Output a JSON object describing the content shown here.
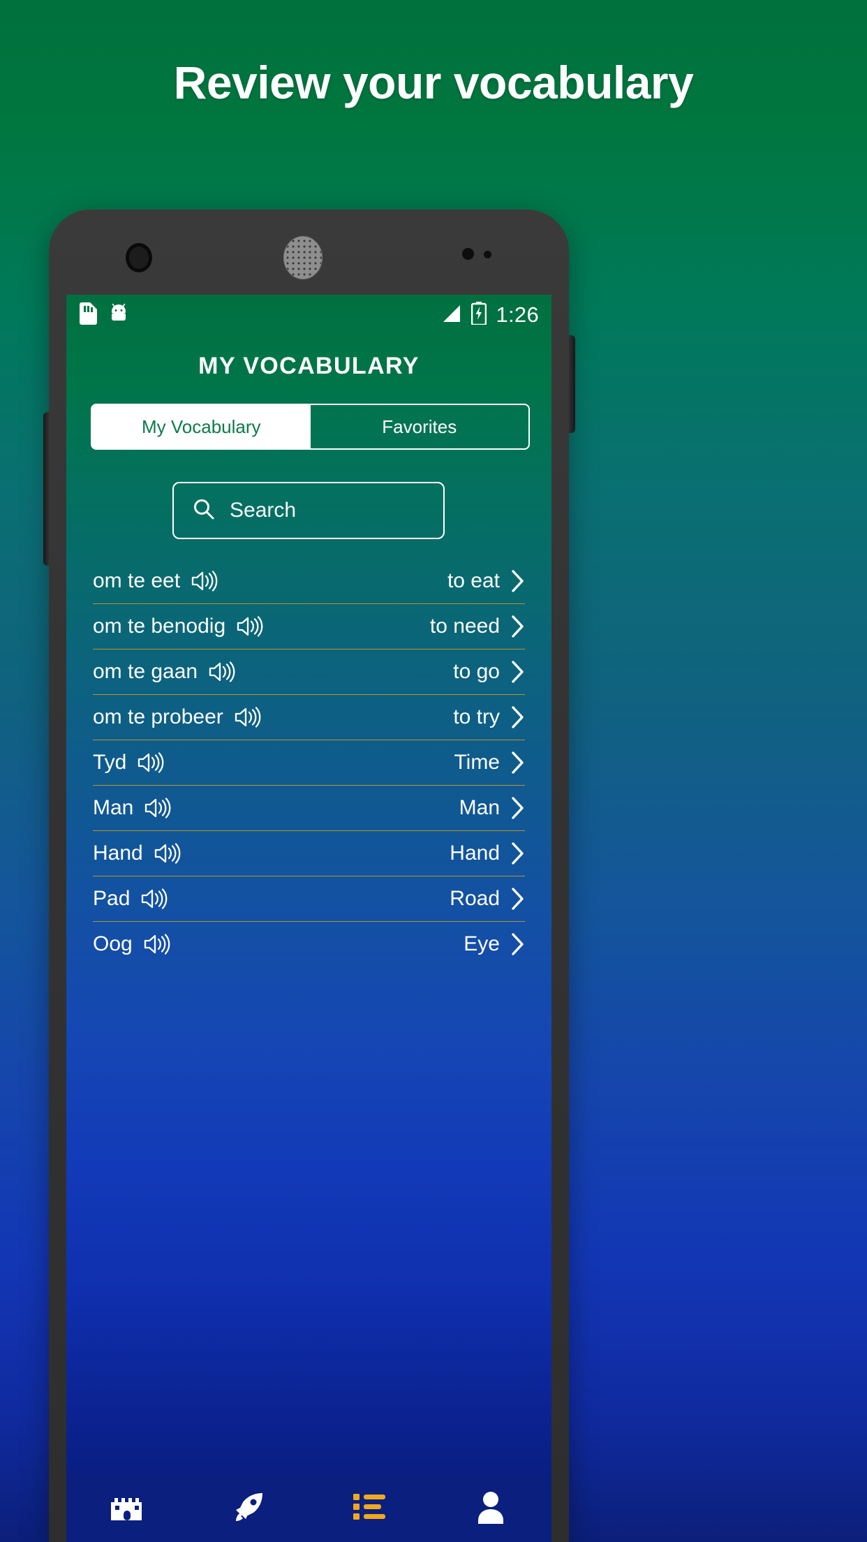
{
  "promo": {
    "headline": "Review your vocabulary"
  },
  "phone": {
    "hardware": {
      "camera": "front-camera",
      "speaker": "earpiece-speaker",
      "sensor_large": "proximity-sensor",
      "sensor_small": "light-sensor"
    }
  },
  "statusbar": {
    "left_icons": [
      "sim-card-icon",
      "android-robot-icon"
    ],
    "right_icons": [
      "signal-strength-icon",
      "battery-charging-icon"
    ],
    "time": "1:26"
  },
  "appbar": {
    "title": "MY VOCABULARY"
  },
  "tabs": [
    {
      "label": "My Vocabulary",
      "active": true
    },
    {
      "label": "Favorites",
      "active": false
    }
  ],
  "search": {
    "icon": "search-icon",
    "placeholder": "Search",
    "value": ""
  },
  "vocabulary": {
    "divider_color": "#b9932f",
    "items": [
      {
        "source": "om te eet",
        "target": "to eat",
        "audio_icon": "speaker-icon",
        "chevron": "chevron-right-icon"
      },
      {
        "source": "om te benodig",
        "target": "to need",
        "audio_icon": "speaker-icon",
        "chevron": "chevron-right-icon"
      },
      {
        "source": "om te gaan",
        "target": "to go",
        "audio_icon": "speaker-icon",
        "chevron": "chevron-right-icon"
      },
      {
        "source": "om te probeer",
        "target": "to try",
        "audio_icon": "speaker-icon",
        "chevron": "chevron-right-icon"
      },
      {
        "source": "Tyd",
        "target": "Time",
        "audio_icon": "speaker-icon",
        "chevron": "chevron-right-icon"
      },
      {
        "source": "Man",
        "target": "Man",
        "audio_icon": "speaker-icon",
        "chevron": "chevron-right-icon"
      },
      {
        "source": "Hand",
        "target": "Hand",
        "audio_icon": "speaker-icon",
        "chevron": "chevron-right-icon"
      },
      {
        "source": "Pad",
        "target": "Road",
        "audio_icon": "speaker-icon",
        "chevron": "chevron-right-icon"
      },
      {
        "source": "Oog",
        "target": "Eye",
        "audio_icon": "speaker-icon",
        "chevron": "chevron-right-icon"
      }
    ]
  },
  "bottomnav": {
    "background": "#0a1f7e",
    "items": [
      {
        "icon": "castle-icon",
        "active": false
      },
      {
        "icon": "rocket-icon",
        "active": false
      },
      {
        "icon": "list-icon",
        "active": true
      },
      {
        "icon": "person-icon",
        "active": false
      }
    ],
    "list_icon_color": "#f0a81e"
  },
  "colors": {
    "gradient_top": "#00703c",
    "gradient_mid": "#10627f",
    "gradient_bottom": "#0b1f7a",
    "accent_gold": "#b9932f",
    "tab_active_text": "#0d7a4a"
  }
}
